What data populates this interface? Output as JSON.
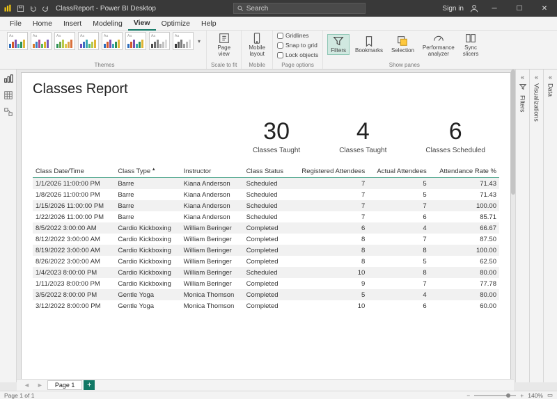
{
  "titlebar": {
    "title": "ClassReport - Power BI Desktop",
    "search_placeholder": "Search",
    "signin": "Sign in"
  },
  "menutabs": [
    "File",
    "Home",
    "Insert",
    "Modeling",
    "View",
    "Optimize",
    "Help"
  ],
  "menutab_active": "View",
  "ribbon": {
    "themes_label": "Themes",
    "scale_label": "Scale to fit",
    "page_view": "Page\nview",
    "mobile_layout": "Mobile\nlayout",
    "mobile_label": "Mobile",
    "optGridlines": "Gridlines",
    "optSnap": "Snap to grid",
    "optLock": "Lock objects",
    "page_options_label": "Page options",
    "filters": "Filters",
    "bookmarks": "Bookmarks",
    "selection": "Selection",
    "perf": "Performance\nanalyzer",
    "sync": "Sync\nslicers",
    "show_panes_label": "Show panes"
  },
  "right_rails": {
    "filters": "Filters",
    "visualizations": "Visualizations",
    "data": "Data"
  },
  "report": {
    "title": "Classes Report",
    "kpis": [
      {
        "value": "30",
        "label": "Classes Taught"
      },
      {
        "value": "4",
        "label": "Classes Taught"
      },
      {
        "value": "6",
        "label": "Classes Scheduled"
      }
    ],
    "columns": [
      "Class Date/Time",
      "Class Type",
      "Instructor",
      "Class Status",
      "Registered Attendees",
      "Actual Attendees",
      "Attendance Rate %"
    ],
    "rows": [
      [
        "1/1/2026 11:00:00 PM",
        "Barre",
        "Kiana Anderson",
        "Scheduled",
        "7",
        "5",
        "71.43"
      ],
      [
        "1/8/2026 11:00:00 PM",
        "Barre",
        "Kiana Anderson",
        "Scheduled",
        "7",
        "5",
        "71.43"
      ],
      [
        "1/15/2026 11:00:00 PM",
        "Barre",
        "Kiana Anderson",
        "Scheduled",
        "7",
        "7",
        "100.00"
      ],
      [
        "1/22/2026 11:00:00 PM",
        "Barre",
        "Kiana Anderson",
        "Scheduled",
        "7",
        "6",
        "85.71"
      ],
      [
        "8/5/2022 3:00:00 AM",
        "Cardio Kickboxing",
        "William Beringer",
        "Completed",
        "6",
        "4",
        "66.67"
      ],
      [
        "8/12/2022 3:00:00 AM",
        "Cardio Kickboxing",
        "William Beringer",
        "Completed",
        "8",
        "7",
        "87.50"
      ],
      [
        "8/19/2022 3:00:00 AM",
        "Cardio Kickboxing",
        "William Beringer",
        "Completed",
        "8",
        "8",
        "100.00"
      ],
      [
        "8/26/2022 3:00:00 AM",
        "Cardio Kickboxing",
        "William Beringer",
        "Completed",
        "8",
        "5",
        "62.50"
      ],
      [
        "1/4/2023 8:00:00 PM",
        "Cardio Kickboxing",
        "William Beringer",
        "Scheduled",
        "10",
        "8",
        "80.00"
      ],
      [
        "1/11/2023 8:00:00 PM",
        "Cardio Kickboxing",
        "William Beringer",
        "Completed",
        "9",
        "7",
        "77.78"
      ],
      [
        "3/5/2022 8:00:00 PM",
        "Gentle Yoga",
        "Monica Thomson",
        "Completed",
        "5",
        "4",
        "80.00"
      ],
      [
        "3/12/2022 8:00:00 PM",
        "Gentle Yoga",
        "Monica Thomson",
        "Completed",
        "10",
        "6",
        "60.00"
      ]
    ]
  },
  "pagetab": "Page 1",
  "status": {
    "left": "Page 1 of 1",
    "zoom": "140%"
  },
  "theme_palettes": [
    [
      "#2d6dbb",
      "#d45a2a",
      "#7a4fb0",
      "#3ba7b6",
      "#2c9157",
      "#e0b534"
    ],
    [
      "#d97a2a",
      "#3b7fc4",
      "#b14a8a",
      "#5bba5b",
      "#d9b52a",
      "#7a5bba"
    ],
    [
      "#2c9157",
      "#6fa84f",
      "#b8c94a",
      "#e0c94a",
      "#e0a34a",
      "#d9703b"
    ],
    [
      "#6f4fbb",
      "#3b6fc4",
      "#3ba7b6",
      "#4fb379",
      "#b8c94a",
      "#e0b534"
    ],
    [
      "#2d6dbb",
      "#d45a2a",
      "#7a4fb0",
      "#3ba7b6",
      "#2c9157",
      "#e0b534"
    ],
    [
      "#2d6dbb",
      "#d45a2a",
      "#7a4fb0",
      "#3ba7b6",
      "#2c9157",
      "#e0b534"
    ],
    [
      "#4a4a4a",
      "#6a6a6a",
      "#8a8a8a",
      "#aaaaaa",
      "#c4c4c4",
      "#dedede"
    ],
    [
      "#3b3b3b",
      "#5b5b5b",
      "#7b7b7b",
      "#9b9b9b",
      "#bbbbbb",
      "#dbdbdb"
    ]
  ]
}
